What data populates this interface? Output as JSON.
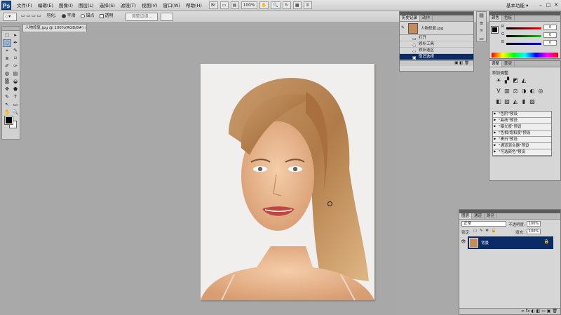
{
  "app": {
    "logo": "Ps",
    "workspace": "基本功能 ▾"
  },
  "menu": [
    "文件(F)",
    "编辑(E)",
    "图像(I)",
    "图层(L)",
    "选择(S)",
    "滤镜(T)",
    "视图(V)",
    "窗口(W)",
    "帮助(H)"
  ],
  "menu_tools": [
    "Br",
    "▭",
    "▤",
    "100%",
    "✋",
    "🔍",
    "↻",
    "▦",
    "⌸"
  ],
  "window_controls": {
    "minimize": "–",
    "restore": "□",
    "close": "✕"
  },
  "options": {
    "feather_label": "羽化:",
    "feather_value": "0 px",
    "radio_smooth": "平滑",
    "radio_corner": "锚点",
    "checkbox_transparent": "透明",
    "adjust_edge": "调整边缘..."
  },
  "document": {
    "tab_title": "人物修复.jpg @ 100%(RGB/8#) ×"
  },
  "tools": [
    "⬚",
    "▸",
    "◌",
    "✒",
    "⌖",
    "✎",
    "⧈",
    "⌑",
    "✐",
    "✑",
    "◍",
    "▤",
    "▒",
    "◒",
    "✥",
    "⬟",
    "✎",
    "T",
    "↖",
    "▭",
    "✋",
    "🔍"
  ],
  "history": {
    "tabs": [
      "历史记录",
      "动作"
    ],
    "snapshot": "人物修复.jpg",
    "items": [
      "打开",
      "修补工具",
      "修补选区",
      "取消选择"
    ],
    "footer_icons": "▣ ◧ 🗑"
  },
  "side_icons": [
    "▤",
    "≡",
    "⌾",
    "▭"
  ],
  "color": {
    "tabs": [
      "颜色",
      "色板"
    ],
    "r": {
      "label": "R",
      "value": "0",
      "color": "#cc0000"
    },
    "g": {
      "label": "G",
      "value": "0",
      "color": "#00aa00"
    },
    "b": {
      "label": "B",
      "value": "0",
      "color": "#0000cc"
    }
  },
  "adjustments": {
    "tabs": [
      "调整",
      "蒙版"
    ],
    "title": "添加调整",
    "row1": [
      "☀",
      "▞",
      "◩",
      "◭"
    ],
    "row2": [
      "V",
      "▥",
      "⚖",
      "◑",
      "◐",
      "◎"
    ],
    "row3": [
      "◧",
      "▨",
      "◭",
      "▮",
      "▨"
    ],
    "presets": [
      "\"色阶\"预设",
      "\"曲线\"预设",
      "\"曝光度\"预设",
      "\"色相/饱和度\"预设",
      "\"黑白\"预设",
      "\"通道混合器\"预设",
      "\"可选颜色\"预设"
    ]
  },
  "layers": {
    "tabs": [
      "图层",
      "通道",
      "路径"
    ],
    "blend_mode": "正常",
    "opacity_label": "不透明度:",
    "opacity_value": "100%",
    "lock_label": "锁定:",
    "fill_label": "填充:",
    "fill_value": "100%",
    "layer_name": "背景",
    "layer_lock": "🔒",
    "eye": "👁",
    "footer_icons": "∞ fx ◐ ◧ ▭ ▣ 🗑"
  }
}
